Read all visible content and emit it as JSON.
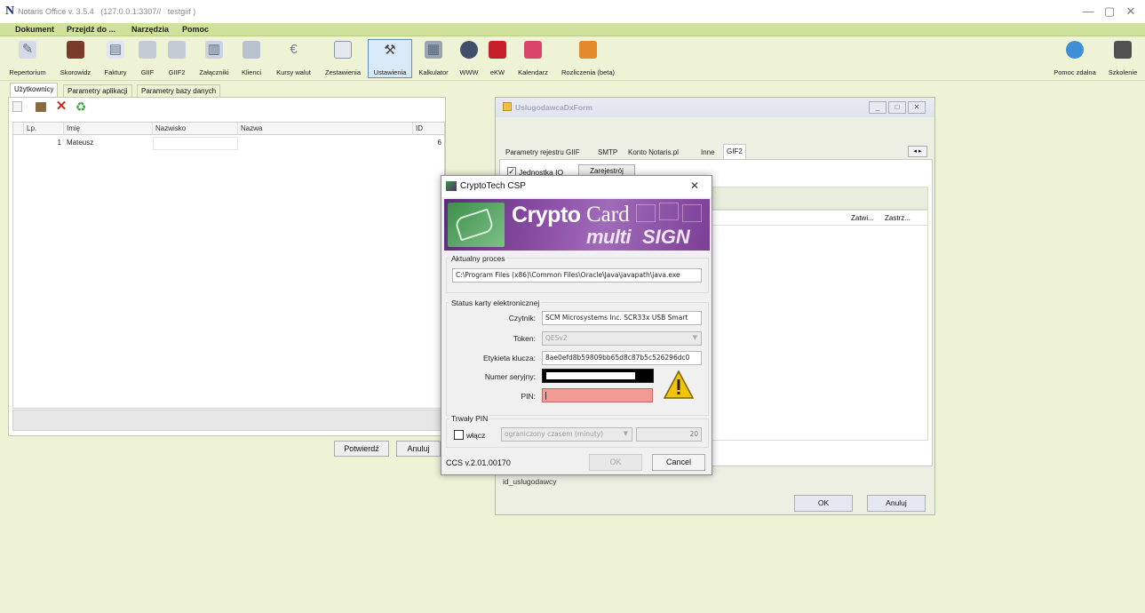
{
  "window": {
    "logo": "N",
    "title": "Notaris Office v. 3.5.4   (127.0.0.1:3307//   testgiif )",
    "minimize": "—",
    "maximize": "▢",
    "close": "✕"
  },
  "menu": [
    "Dokument",
    "Przejdź do ...",
    "Narzędzia",
    "Pomoc"
  ],
  "toolbar": [
    {
      "label": "Repertorium",
      "icon": "repertorium-icon"
    },
    {
      "label": "Skorowidz",
      "icon": "book-icon"
    },
    {
      "label": "Faktury",
      "icon": "invoice-icon"
    },
    {
      "label": "GIIF",
      "icon": "folder-icon"
    },
    {
      "label": "GIIF2",
      "icon": "folder-icon"
    },
    {
      "label": "Załączniki",
      "icon": "attachment-icon"
    },
    {
      "label": "Klienci",
      "icon": "clients-icon"
    },
    {
      "label": "Kursy walut",
      "icon": "euro-icon"
    },
    {
      "label": "Zestawienia",
      "icon": "report-icon"
    },
    {
      "label": "Ustawienia",
      "icon": "settings-icon"
    },
    {
      "label": "Kalkulator",
      "icon": "calculator-icon"
    },
    {
      "label": "WWW",
      "icon": "globe-icon"
    },
    {
      "label": "eKW",
      "icon": "ekw-icon"
    },
    {
      "label": "Kalendarz",
      "icon": "calendar-icon"
    },
    {
      "label": "Rozliczenia (beta)",
      "icon": "billing-icon"
    }
  ],
  "toolbar_right": [
    {
      "label": "Pomoc zdalna",
      "icon": "lifebuoy-icon"
    },
    {
      "label": "Szkolenie",
      "icon": "clapperboard-icon"
    }
  ],
  "tabs": [
    "Użytkownicy",
    "Parametry aplikacji",
    "Parametry bazy danych"
  ],
  "grid": {
    "columns": [
      "Lp.",
      "Imię",
      "Nazwisko",
      "Nazwa",
      "ID"
    ],
    "rows": [
      {
        "lp": "1",
        "imie": "Mateusz",
        "nazwisko": "",
        "nazwa": "",
        "id": "6"
      }
    ]
  },
  "buttons": {
    "confirm": "Potwierdź",
    "cancel": "Anuluj"
  },
  "uslugodawca": {
    "title": "UslugodawcaDxForm",
    "title_buttons": [
      "_",
      "□",
      "✕"
    ],
    "tabs": [
      "Parametry rejestru GIIF",
      "SMTP",
      "Konto Notaris.pl",
      "Inne",
      "GIF2"
    ],
    "tab_scroll": "◂ ▸",
    "checkbox_label": "Jednostka IO",
    "register_button": "Zarejestrój",
    "columns": [
      "Zatwi...",
      "Zastrz..."
    ],
    "field_label": "id_uslugodawcy",
    "ok": "OK",
    "cancel": "Anuluj"
  },
  "crypto": {
    "title": "CryptoTech CSP",
    "close": "✕",
    "banner_crypto": "Crypto",
    "banner_card": "Card",
    "banner_multi": "multi",
    "banner_sign": "SIGN",
    "process_group": "Aktualny proces",
    "process_path": "C:\\Program Files (x86)\\Common Files\\Oracle\\Java\\javapath\\java.exe",
    "status_group": "Status karty elektronicznej",
    "reader_label": "Czytnik:",
    "reader_value": "SCM Microsystems Inc. SCR33x USB Smart",
    "token_label": "Token:",
    "token_value": "QESv2",
    "key_label": "Etykieta klucza:",
    "key_value": "8ae0efd8b59809bb65d8c87b5c526296dc0",
    "serial_label": "Numer seryjny:",
    "pin_label": "PIN:",
    "persistent_group": "Trwały PIN",
    "enable_label": "włącz",
    "limit_option": "ograniczony czasem (minuty)",
    "limit_minutes": "20",
    "version": "CCS v.2.01.00170",
    "ok": "OK",
    "cancel": "Cancel"
  },
  "colors": {
    "background": "#eef3d6",
    "menubar": "#cfe19b",
    "banner_purple": "#8c4fa6",
    "pin_field": "#f29b94",
    "warning": "#f2c40d"
  }
}
